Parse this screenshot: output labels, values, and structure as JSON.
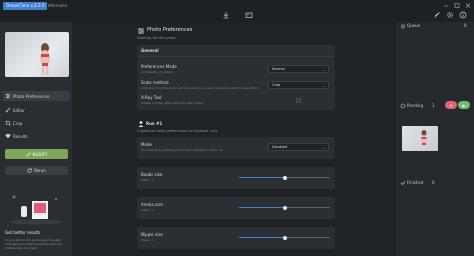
{
  "app": {
    "title": "DreamTime v 1.2.3",
    "greeting": "Good afternoon"
  },
  "sidebar": {
    "nav": [
      {
        "label": "Photo Preferences",
        "icon": "sliders-icon"
      },
      {
        "label": "Editor",
        "icon": "brush-icon"
      },
      {
        "label": "Crop",
        "icon": "crop-icon"
      },
      {
        "label": "Results",
        "icon": "heart-icon"
      }
    ],
    "nudify_label": "NUDIFY",
    "rerun_label": "Rerun",
    "promo_title": "Get better results",
    "promo_text": "Is your photo not giving good results? Changing and experimenting with the preferences can help."
  },
  "main": {
    "page_title": "Photo Preferences",
    "page_subtitle": "Settings for the photo.",
    "general": {
      "title": "General",
      "preferences_mode_label": "Preferences Mode",
      "preferences_mode_hint": "Complexity of options",
      "preferences_mode_value": "Normal",
      "scale_method_label": "Scale method",
      "scale_method_hint": "Indicates how the photo will be scaled to a size compatible with the algorithm.",
      "scale_method_value": "Crop",
      "xray_label": "X-Ray Tool",
      "xray_hint": "Create a X-Ray effect with the last model."
    },
    "run": {
      "title": "Run #1",
      "subtitle": "Customize body preferences for multiple runs.",
      "mode_label": "Mode",
      "mode_hint": "How the body preferences will be changed in each run.",
      "mode_value": "Disabled"
    },
    "sliders": [
      {
        "label": "Boobs size",
        "hint": "Value: 1",
        "value": 0.5
      },
      {
        "label": "Areola size",
        "hint": "Value: 1",
        "value": 0.5
      },
      {
        "label": "Nipple size",
        "hint": "Value: 1",
        "value": 0.5
      }
    ]
  },
  "queue": {
    "queue_label": "Queue",
    "queue_count": "0",
    "pending_label": "Pending",
    "pending_count": "1",
    "pending_play": "▶",
    "pending_stop": "✕",
    "finished_label": "Finished",
    "finished_count": "0"
  },
  "colors": {
    "accent": "#3f7fd6",
    "nudify_green": "#7ea75a",
    "pending_green": "#6ec06e",
    "pending_red": "#e26470"
  }
}
